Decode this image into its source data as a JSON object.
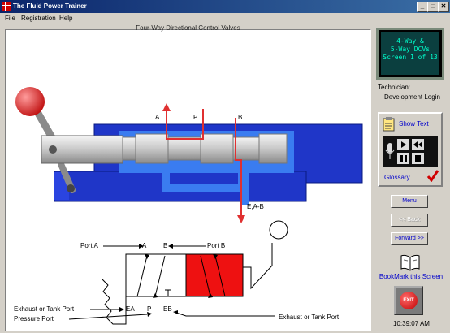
{
  "window": {
    "title": "The Fluid Power Trainer",
    "controls": {
      "minimize": "_",
      "maximize": "□",
      "close": "✕"
    }
  },
  "menu": {
    "items": [
      "File",
      "Registration",
      "Help"
    ]
  },
  "canvas": {
    "title": "Four-Way Directional Control Valves",
    "valve_ports": {
      "a": "A",
      "p": "P",
      "b": "B",
      "exhaust": "E,A-B"
    },
    "symbol": {
      "port_a_label": "Port A",
      "port_b_label": "Port B",
      "letter_a": "A",
      "letter_b": "B",
      "letter_ea": "EA",
      "letter_p": "P",
      "letter_eb": "EB",
      "exhaust_left_label": "Exhaust or Tank Port",
      "pressure_label": "Pressure Port",
      "exhaust_right_label": "Exhaust or Tank Port"
    }
  },
  "sidebar": {
    "screen_text": {
      "line1": "4-Way &",
      "line2": "5-Way DCVs",
      "line3": "Screen 1 of 13"
    },
    "technician_label": "Technician:",
    "technician_name": "Development Login",
    "show_text": "Show Text",
    "glossary": "Glossary",
    "menu_button": "Menu",
    "back_button": "<< Back",
    "forward_button": "Forward >>",
    "bookmark": "BookMark this Screen",
    "exit": "EXIT",
    "time": "10:39:07 AM"
  },
  "colors": {
    "titlebar": "#0a246a",
    "valve_body": "#1f36c8",
    "valve_passage": "#3a7cf0",
    "flow_line": "#e03030",
    "symbol_active": "#ee1111",
    "link": "#0000cc"
  }
}
